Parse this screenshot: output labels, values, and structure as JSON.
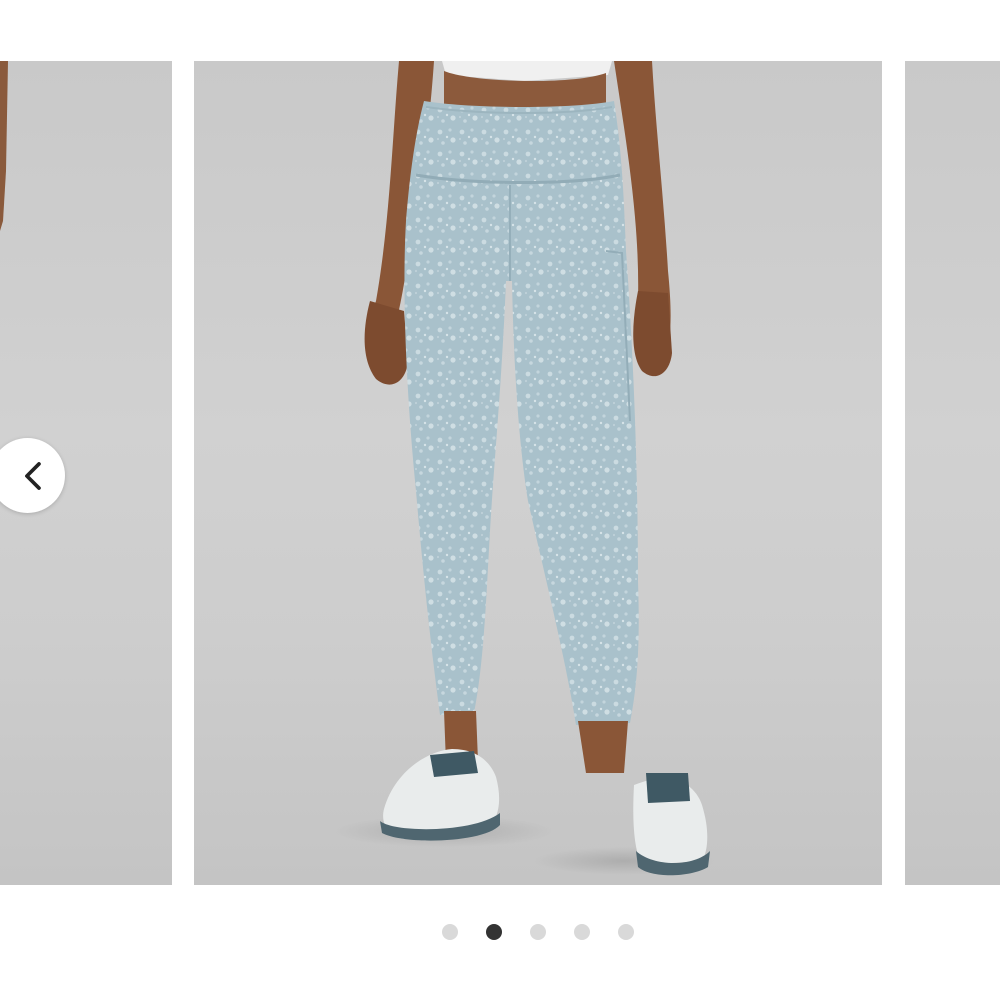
{
  "carousel": {
    "total_slides": 5,
    "active_index": 1
  },
  "product_image": {
    "subject": "woman-wearing-leggings",
    "leggings_color": "#a9c1cb",
    "sneaker_color": "#e9ecec"
  },
  "icons": {
    "prev": "chevron-left-icon"
  },
  "colors": {
    "dot_active": "#333333",
    "dot_inactive": "#d9d9d9",
    "background": "#ffffff"
  }
}
